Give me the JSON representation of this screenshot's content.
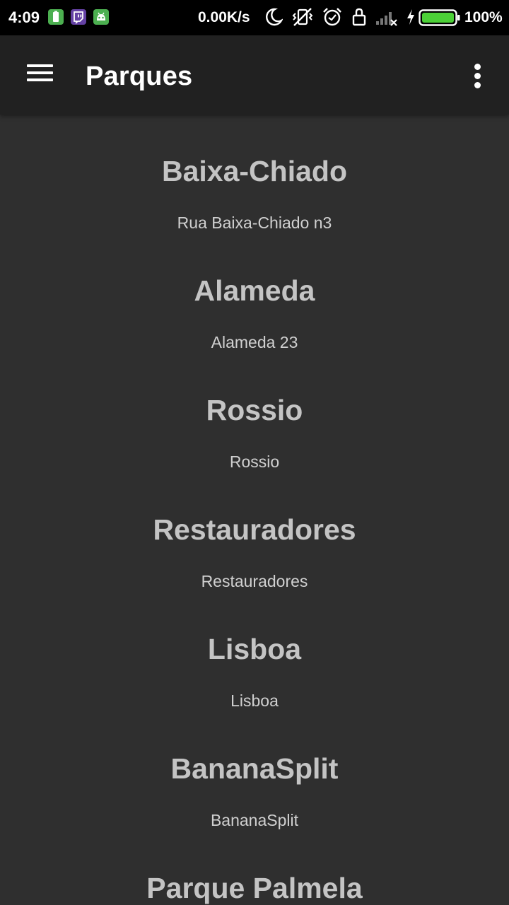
{
  "status_bar": {
    "time": "4:09",
    "network_speed": "0.00K/s",
    "battery_percent": "100%",
    "app_icons": [
      "battery-saver-app-icon",
      "twitch-app-icon",
      "android-app-icon"
    ],
    "system_icons": [
      "moon-icon",
      "vibrate-off-icon",
      "alarm-clock-icon",
      "lock-rotation-icon",
      "signal-no-service-icon",
      "charging-bolt-icon",
      "battery-full-icon"
    ],
    "colors": {
      "battery_fill": "#4cd137",
      "twitch": "#6441a4",
      "app_green": "#4caf50"
    }
  },
  "app_bar": {
    "title": "Parques",
    "menu_icon": "hamburger-menu-icon",
    "overflow_icon": "more-vertical-icon",
    "background": "#212121"
  },
  "parks": [
    {
      "name": "Baixa-Chiado",
      "address": "Rua Baixa-Chiado n3"
    },
    {
      "name": "Alameda",
      "address": "Alameda 23"
    },
    {
      "name": "Rossio",
      "address": "Rossio"
    },
    {
      "name": "Restauradores",
      "address": "Restauradores"
    },
    {
      "name": "Lisboa",
      "address": "Lisboa"
    },
    {
      "name": "BananaSplit",
      "address": "BananaSplit"
    },
    {
      "name": "Parque Palmela",
      "address": ""
    }
  ],
  "colors": {
    "background": "#2f2f2f",
    "park_name": "#c4c4c4",
    "park_address": "#d0d0d0"
  }
}
